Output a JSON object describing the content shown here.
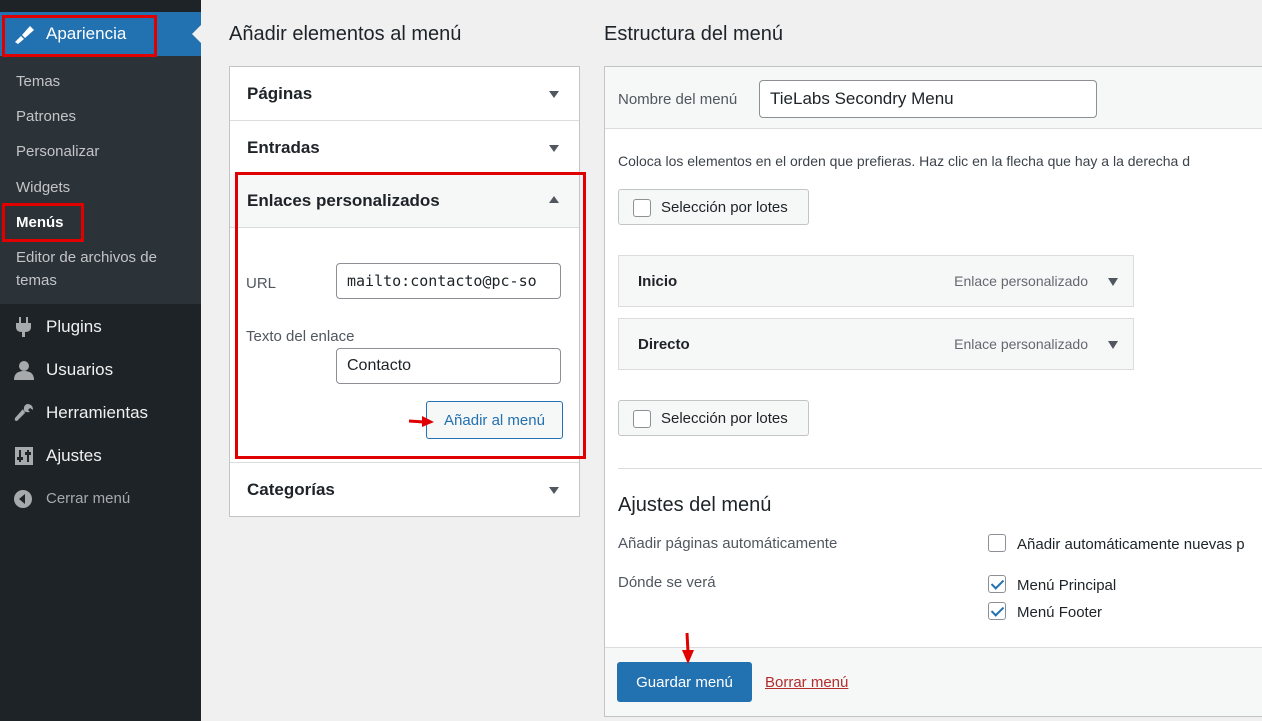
{
  "sidebar": {
    "current_parent": "Apariencia",
    "submenu": [
      "Temas",
      "Patrones",
      "Personalizar",
      "Widgets",
      "Menús",
      "Editor de archivos de",
      "temas"
    ],
    "items": [
      "Plugins",
      "Usuarios",
      "Herramientas",
      "Ajustes"
    ],
    "collapse_label": "Cerrar menú"
  },
  "add_items": {
    "title": "Añadir elementos al menú",
    "sections": {
      "pages": "Páginas",
      "posts": "Entradas",
      "custom_links": "Enlaces personalizados",
      "categories": "Categorías"
    },
    "url_label": "URL",
    "url_value": "mailto:contacto@pc-so",
    "link_text_label": "Texto del enlace",
    "link_text_value": "Contacto",
    "add_button": "Añadir al menú"
  },
  "structure": {
    "title": "Estructura del menú",
    "name_label": "Nombre del menú",
    "name_value": "TieLabs Secondry Menu",
    "instructions": "Coloca los elementos en el orden que prefieras. Haz clic en la flecha que hay a la derecha d",
    "bulk_select": "Selección por lotes",
    "items": [
      {
        "title": "Inicio",
        "type": "Enlace personalizado"
      },
      {
        "title": "Directo",
        "type": "Enlace personalizado"
      }
    ]
  },
  "settings": {
    "title": "Ajustes del menú",
    "auto_add_label": "Añadir páginas automáticamente",
    "auto_add_option": "Añadir automáticamente nuevas p",
    "display_label": "Dónde se verá",
    "locations": [
      "Menú Principal",
      "Menú Footer"
    ]
  },
  "actions": {
    "save": "Guardar menú",
    "delete": "Borrar menú"
  },
  "colors": {
    "accent": "#2271b1",
    "sidebar_bg": "#1d2327",
    "highlight": "#e00000"
  }
}
